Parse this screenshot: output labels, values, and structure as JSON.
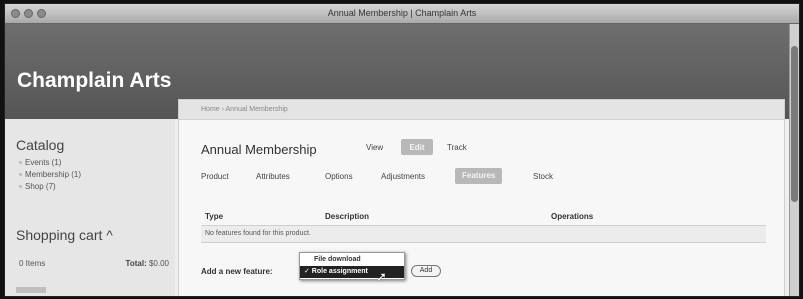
{
  "window": {
    "title": "Annual Membership | Champlain Arts"
  },
  "site": {
    "name": "Champlain Arts"
  },
  "breadcrumb": "Home › Annual Membership",
  "sidebar": {
    "catalog_title": "Catalog",
    "catalog_items": [
      "Events (1)",
      "Membership (1)",
      "Shop (7)"
    ],
    "cart_title": "Shopping cart ^",
    "cart_items": "0 Items",
    "cart_total_label": "Total:",
    "cart_total_value": "$0.00"
  },
  "page": {
    "title": "Annual Membership",
    "view_tabs": [
      "View",
      "Edit",
      "Track"
    ],
    "active_view_tab": "Edit",
    "sub_tabs": [
      "Product",
      "Attributes",
      "Options",
      "Adjustments",
      "Features",
      "Stock"
    ],
    "active_sub_tab": "Features"
  },
  "table": {
    "headers": [
      "Type",
      "Description",
      "Operations"
    ],
    "empty_message": "No features found for this product."
  },
  "add_feature": {
    "label": "Add a new feature:",
    "options": [
      "File download",
      "✓ Role assignment"
    ],
    "selected": "Role assignment",
    "button": "Add"
  },
  "colors": {
    "header_bg": "#5f5f5f",
    "active_tab_bg": "#b8b8b8",
    "selected_option_bg": "#222222"
  }
}
